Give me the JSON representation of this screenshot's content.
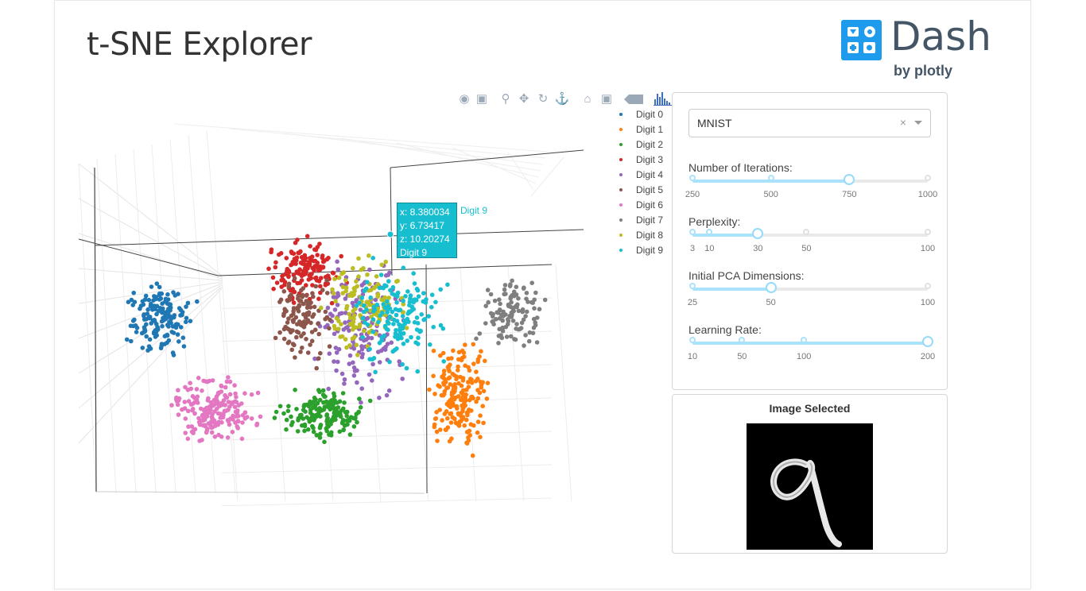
{
  "app": {
    "title": "t-SNE Explorer"
  },
  "logo": {
    "word": "Dash",
    "by": "by plotly"
  },
  "modebar": {
    "buttons": [
      "camera-icon",
      "save-icon",
      "zoom-icon",
      "pan-icon",
      "orbit-icon",
      "turntable-icon",
      "home-icon",
      "camera-reset-icon",
      "spike-icon",
      "chart-icon"
    ]
  },
  "legend": {
    "items": [
      {
        "label": "Digit 0",
        "color": "#1f77b4"
      },
      {
        "label": "Digit 1",
        "color": "#ff7f0e"
      },
      {
        "label": "Digit 2",
        "color": "#2ca02c"
      },
      {
        "label": "Digit 3",
        "color": "#d62728"
      },
      {
        "label": "Digit 4",
        "color": "#9467bd"
      },
      {
        "label": "Digit 5",
        "color": "#8c564b"
      },
      {
        "label": "Digit 6",
        "color": "#e377c2"
      },
      {
        "label": "Digit 7",
        "color": "#7f7f7f"
      },
      {
        "label": "Digit 8",
        "color": "#bcbd22"
      },
      {
        "label": "Digit 9",
        "color": "#17becf"
      }
    ]
  },
  "tooltip": {
    "x": "x: 8.380034",
    "y": "y: 6.73417",
    "z": "z: 10.20274",
    "name": "Digit 9",
    "trace": "Digit 9"
  },
  "controls": {
    "dataset": {
      "value": "MNIST",
      "clear": "×"
    },
    "sliders": [
      {
        "label": "Number of Iterations:",
        "min": 250,
        "max": 1000,
        "value": 750,
        "marks": [
          "250",
          "500",
          "750",
          "1000"
        ]
      },
      {
        "label": "Perplexity:",
        "min": 3,
        "max": 100,
        "value": 30,
        "marks": [
          "3",
          "10",
          "30",
          "50",
          "100"
        ]
      },
      {
        "label": "Initial PCA Dimensions:",
        "min": 25,
        "max": 100,
        "value": 50,
        "marks": [
          "25",
          "50",
          "100"
        ]
      },
      {
        "label": "Learning Rate:",
        "min": 10,
        "max": 200,
        "value": 200,
        "marks": [
          "10",
          "50",
          "100",
          "200"
        ]
      }
    ]
  },
  "image_panel": {
    "title": "Image Selected"
  },
  "colors": {
    "accent": "#abe2fb",
    "handle": "#96dbfa",
    "dash_blue": "#1f9bee"
  }
}
